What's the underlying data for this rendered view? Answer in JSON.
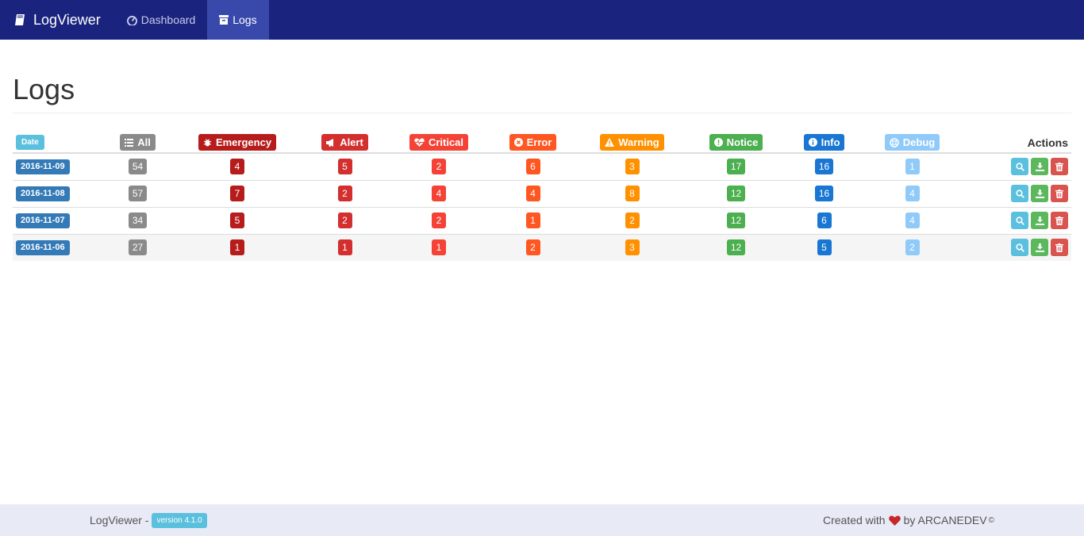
{
  "nav": {
    "brand": "LogViewer",
    "items": [
      {
        "label": "Dashboard",
        "icon": "dashboard-icon",
        "active": false
      },
      {
        "label": "Logs",
        "icon": "archive-icon",
        "active": true
      }
    ]
  },
  "page": {
    "title": "Logs"
  },
  "table": {
    "headers": {
      "date": "Date",
      "all": "All",
      "emergency": "Emergency",
      "alert": "Alert",
      "critical": "Critical",
      "error": "Error",
      "warning": "Warning",
      "notice": "Notice",
      "info": "Info",
      "debug": "Debug",
      "actions": "Actions"
    },
    "colors": {
      "all": "#8a8a8a",
      "emergency": "#b71c1c",
      "alert": "#d32f2f",
      "critical": "#f44336",
      "error": "#ff5722",
      "warning": "#ff9100",
      "notice": "#4caf50",
      "info": "#1976d2",
      "debug": "#90caf9"
    },
    "rows": [
      {
        "date": "2016-11-09",
        "all": "54",
        "emergency": "4",
        "alert": "5",
        "critical": "2",
        "error": "6",
        "warning": "3",
        "notice": "17",
        "info": "16",
        "debug": "1"
      },
      {
        "date": "2016-11-08",
        "all": "57",
        "emergency": "7",
        "alert": "2",
        "critical": "4",
        "error": "4",
        "warning": "8",
        "notice": "12",
        "info": "16",
        "debug": "4"
      },
      {
        "date": "2016-11-07",
        "all": "34",
        "emergency": "5",
        "alert": "2",
        "critical": "2",
        "error": "1",
        "warning": "2",
        "notice": "12",
        "info": "6",
        "debug": "4"
      },
      {
        "date": "2016-11-06",
        "all": "27",
        "emergency": "1",
        "alert": "1",
        "critical": "1",
        "error": "2",
        "warning": "3",
        "notice": "12",
        "info": "5",
        "debug": "2"
      }
    ]
  },
  "footer": {
    "app": "LogViewer -",
    "version": "version 4.1.0",
    "created_prefix": "Created with",
    "created_suffix": "by ARCANEDEV",
    "copyright": "©"
  }
}
